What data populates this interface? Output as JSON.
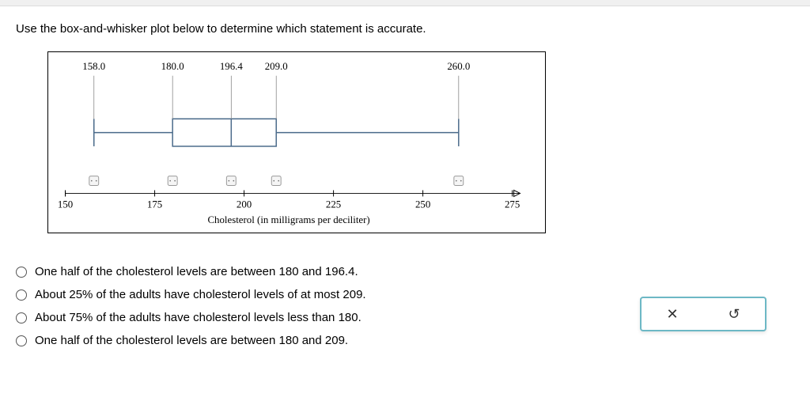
{
  "question": "Use the box-and-whisker plot below to determine which statement is accurate.",
  "chart_data": {
    "type": "boxplot",
    "min": 158.0,
    "q1": 180.0,
    "median": 196.4,
    "q3": 209.0,
    "max": 260.0,
    "xlabel": "Cholesterol (in milligrams per deciliter)",
    "xlim": [
      150,
      275
    ],
    "ticks": [
      150,
      175,
      200,
      225,
      250,
      275
    ],
    "labels": {
      "min": "158.0",
      "q1": "180.0",
      "median": "196.4",
      "q3": "209.0",
      "max": "260.0"
    },
    "tick_labels": {
      "t150": "150",
      "t175": "175",
      "t200": "200",
      "t225": "225",
      "t250": "250",
      "t275": "275"
    }
  },
  "options": {
    "a": "One half of the cholesterol levels are between 180 and 196.4.",
    "b": "About 25% of the adults have cholesterol levels of at most 209.",
    "c": "About 75% of the adults have cholesterol levels less than 180.",
    "d": "One half of the cholesterol levels are between 180 and 209."
  },
  "actions": {
    "close": "✕",
    "reset": "↺"
  }
}
